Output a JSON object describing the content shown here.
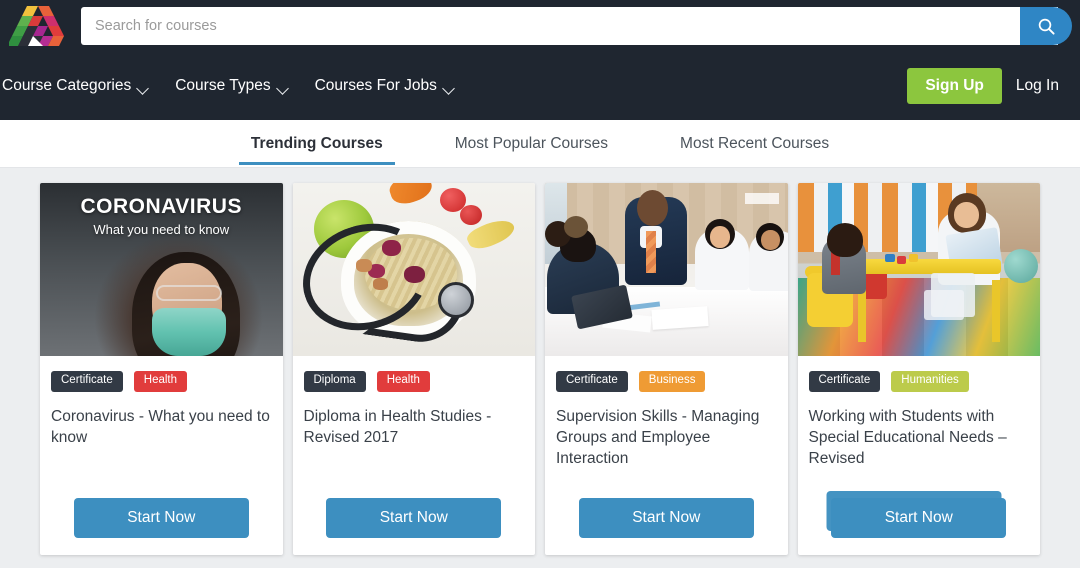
{
  "header": {
    "logo_name": "alison-logo",
    "search": {
      "placeholder": "Search for courses",
      "value": "",
      "button_icon": "search-icon",
      "button_color": "#2f86c5"
    },
    "nav": [
      {
        "label": "Course Categories",
        "has_dropdown": true
      },
      {
        "label": "Course Types",
        "has_dropdown": true
      },
      {
        "label": "Courses For Jobs",
        "has_dropdown": true
      }
    ],
    "signup_label": "Sign Up",
    "signup_color": "#8cc63e",
    "login_label": "Log In",
    "background": "#1f2630"
  },
  "tabs": {
    "items": [
      {
        "label": "Trending Courses",
        "active": true
      },
      {
        "label": "Most Popular Courses",
        "active": false
      },
      {
        "label": "Most Recent Courses",
        "active": false
      }
    ],
    "active_underline_color": "#3d8fc0"
  },
  "cards": [
    {
      "image_overlay_title": "CORONAVIRUS",
      "image_overlay_subtitle": "What you need to know",
      "badges": [
        {
          "label": "Certificate",
          "color": "#323a45"
        },
        {
          "label": "Health",
          "color": "#e13c3c"
        }
      ],
      "title": "Coronavirus - What you need to know",
      "cta_label": "Start Now",
      "cta_color": "#3d8fc0"
    },
    {
      "image_overlay_title": "",
      "image_overlay_subtitle": "",
      "badges": [
        {
          "label": "Diploma",
          "color": "#323a45"
        },
        {
          "label": "Health",
          "color": "#e13c3c"
        }
      ],
      "title": "Diploma in Health Studies - Revised 2017",
      "cta_label": "Start Now",
      "cta_color": "#3d8fc0"
    },
    {
      "image_overlay_title": "",
      "image_overlay_subtitle": "",
      "badges": [
        {
          "label": "Certificate",
          "color": "#323a45"
        },
        {
          "label": "Business",
          "color": "#ef9b34"
        }
      ],
      "title": "Supervision Skills - Managing Groups and Employee Interaction",
      "cta_label": "Start Now",
      "cta_color": "#3d8fc0"
    },
    {
      "image_overlay_title": "",
      "image_overlay_subtitle": "",
      "badges": [
        {
          "label": "Certificate",
          "color": "#323a45"
        },
        {
          "label": "Humanities",
          "color": "#bccb4b"
        }
      ],
      "title": "Working with Students with Special Educational Needs – Revised",
      "cta_label": "Start Now",
      "cta_color": "#3d8fc0",
      "cta_duplicate_label": "Start Now"
    }
  ]
}
